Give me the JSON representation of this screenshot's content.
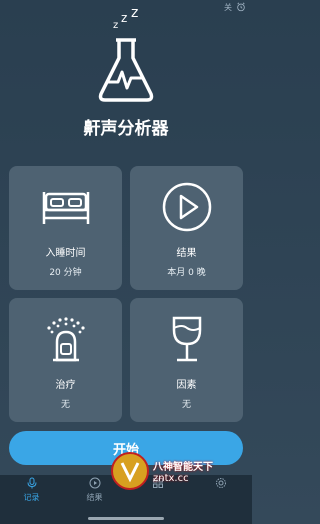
{
  "status_bar": {
    "toggle_text": "关"
  },
  "app": {
    "title": "鼾声分析器"
  },
  "cards": [
    {
      "icon": "bed-icon",
      "title": "入睡时间",
      "value": "20 分钟"
    },
    {
      "icon": "play-icon",
      "title": "结果",
      "value": "本月 0 晚"
    },
    {
      "icon": "inhaler-icon",
      "title": "治疗",
      "value": "无"
    },
    {
      "icon": "wine-glass-icon",
      "title": "因素",
      "value": "无"
    }
  ],
  "start_button": {
    "label": "开始"
  },
  "bottom_nav": [
    {
      "label": "记录",
      "icon": "mic-icon",
      "active": true
    },
    {
      "label": "结果",
      "icon": "play-icon",
      "active": false
    },
    {
      "label": "",
      "icon": "grid-icon",
      "active": false
    },
    {
      "label": "",
      "icon": "gear-icon",
      "active": false
    }
  ],
  "watermark": {
    "main": "八神智能天下",
    "sub": "zntx.cc"
  },
  "colors": {
    "accent": "#3aa6e6",
    "card": "#4e6272",
    "background": "#2a3f50"
  }
}
